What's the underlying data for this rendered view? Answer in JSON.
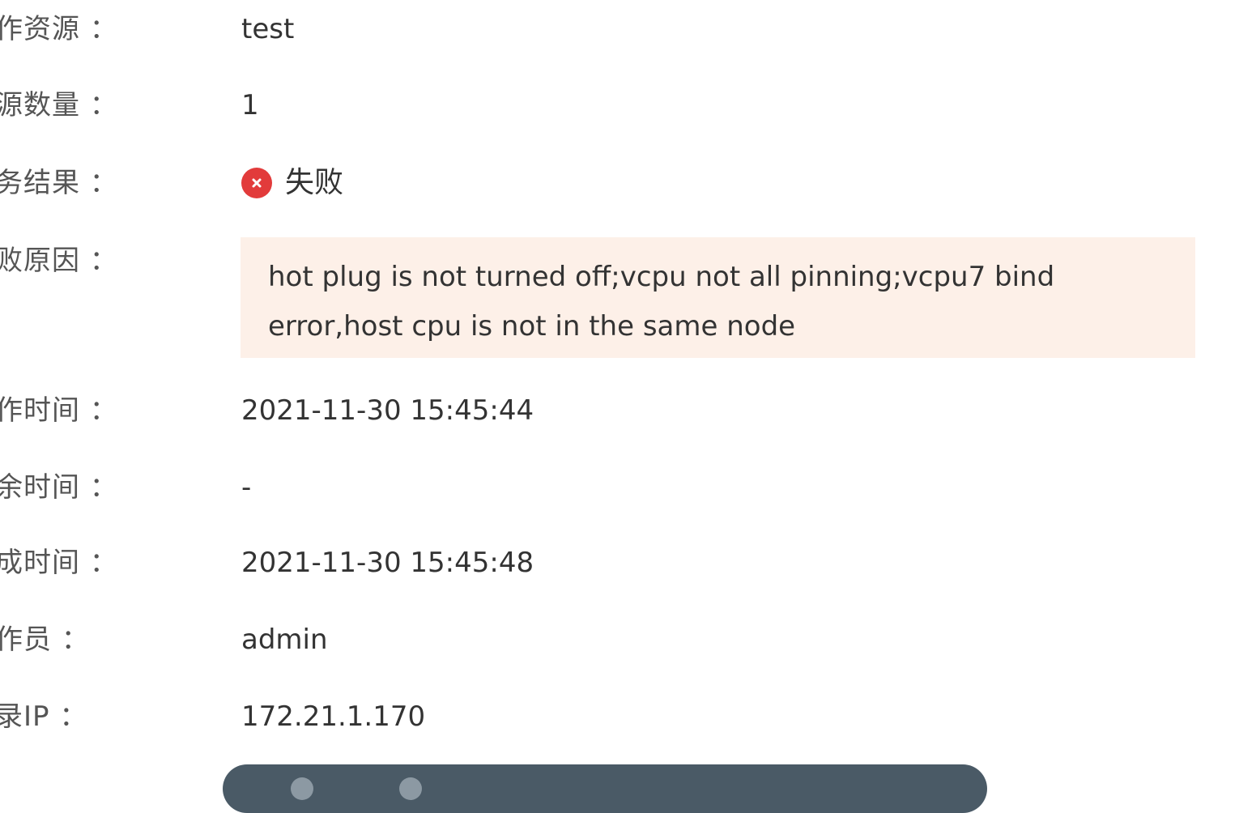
{
  "fields": [
    {
      "label": "作资源 ：",
      "value": "test"
    },
    {
      "label": "源数量 ：",
      "value": "1"
    },
    {
      "label": "务结果 ：",
      "value": "失败"
    },
    {
      "label": "败原因 ：",
      "value": "hot plug is not turned off;vcpu not all pinning;vcpu7 bind error,host cpu is not in the same node"
    },
    {
      "label": "作时间 ：",
      "value": "2021-11-30 15:45:44"
    },
    {
      "label": "余时间 ：",
      "value": "-"
    },
    {
      "label": "成时间 ：",
      "value": "2021-11-30 15:45:48"
    },
    {
      "label": "作员 ：",
      "value": "admin"
    },
    {
      "label": "录IP ：",
      "value": "172.21.1.170"
    }
  ],
  "status": {
    "icon": "close-circle-icon",
    "color": "#e23b3b"
  },
  "reason_box_color": "#fdf0e8",
  "toolbar": {
    "color": "#4a5a66",
    "buttons": [
      {
        "icon": "circle-button-icon"
      },
      {
        "icon": "circle-button-icon"
      }
    ]
  }
}
